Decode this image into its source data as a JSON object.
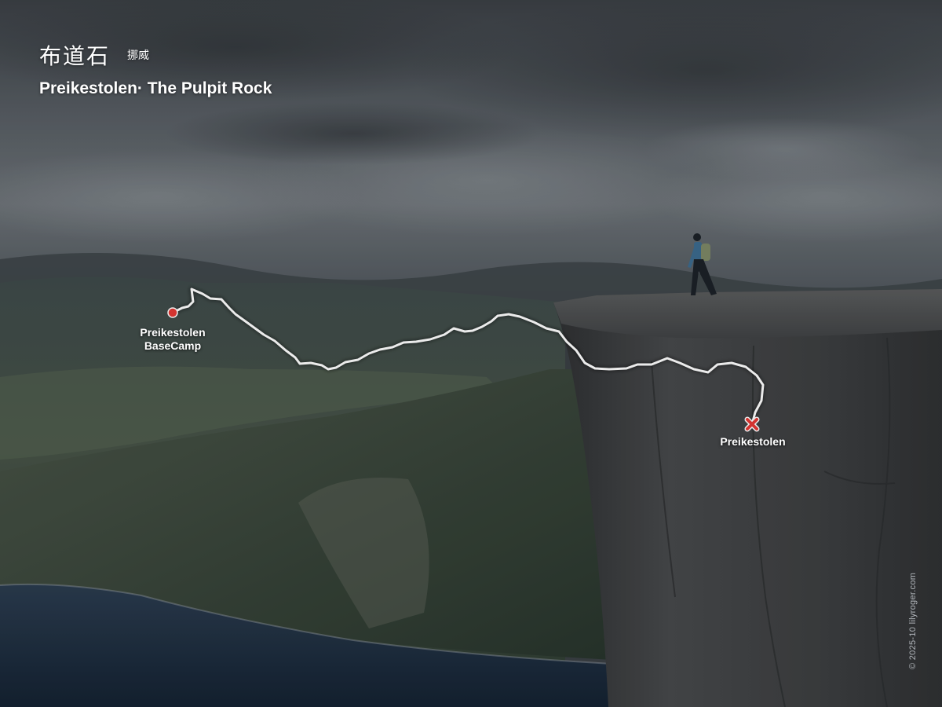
{
  "title": {
    "chinese": "布道石",
    "country": "挪威",
    "english": "Preikestolen· The Pulpit Rock"
  },
  "route": {
    "start_label_line1": "Preikestolen",
    "start_label_line2": "BaseCamp",
    "end_label": "Preikestolen",
    "start_marker_color": "#e53935",
    "end_marker_color": "#e53935",
    "path_color": "#ffffff"
  },
  "credit": "© 2025-10 lilyroger.com",
  "palette": {
    "sky": "#4a5056",
    "cliff": "#3f4143",
    "valley": "#3a473f",
    "fjord": "#1c2a3a"
  }
}
